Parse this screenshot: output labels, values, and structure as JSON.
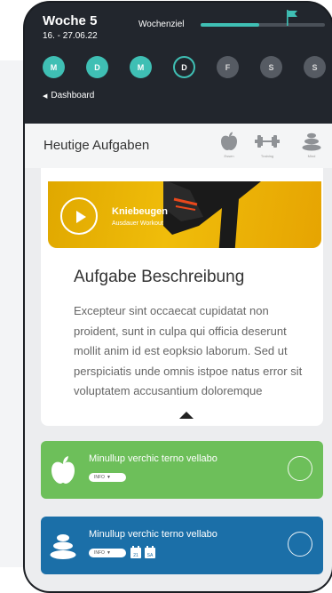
{
  "header": {
    "week_title": "Woche 5",
    "date_range": "16. - 27.06.22",
    "goal_label": "Wochenziel",
    "goal_progress": 0.47,
    "accent_color": "#3fbfb4"
  },
  "days": [
    {
      "label": "M",
      "state": "done"
    },
    {
      "label": "D",
      "state": "done"
    },
    {
      "label": "M",
      "state": "done"
    },
    {
      "label": "D",
      "state": "today"
    },
    {
      "label": "F",
      "state": "future"
    },
    {
      "label": "S",
      "state": "future"
    },
    {
      "label": "S",
      "state": "future"
    }
  ],
  "nav": {
    "back_label": "Dashboard"
  },
  "panel": {
    "title": "Heutige Aufgaben",
    "categories": [
      {
        "icon": "apple-icon",
        "label": "Essen"
      },
      {
        "icon": "dumbbell-icon",
        "label": "Training"
      },
      {
        "icon": "stones-icon",
        "label": "Mind"
      }
    ]
  },
  "video": {
    "title": "Kniebeugen",
    "subtitle": "Ausdauer Workout"
  },
  "description": {
    "title": "Aufgabe Beschreibung",
    "text": "Excepteur sint occaecat cupidatat non proident, sunt in culpa qui officia deserunt mollit anim id est eopksio laborum. Sed ut perspiciatis unde omnis istpoe natus error sit voluptatem accusantium doloremque"
  },
  "tasks": [
    {
      "title": "Minullup verchic terno vellabo",
      "pill": "INFO",
      "icon": "apple-icon",
      "color": "#6dbf5a"
    },
    {
      "title": "Minullup verchic terno vellabo",
      "pill": "INFO",
      "icon": "stones-icon",
      "color": "#1b6fa8",
      "calendar": [
        "21",
        "SA"
      ]
    }
  ]
}
